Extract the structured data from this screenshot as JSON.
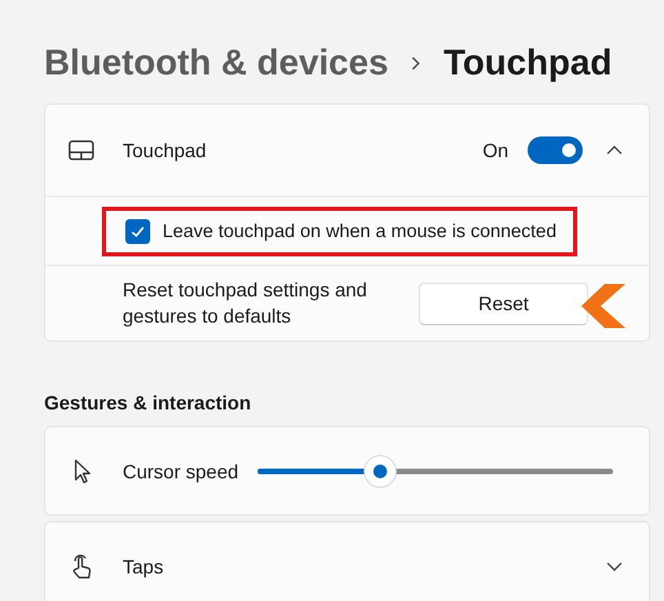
{
  "breadcrumb": {
    "parent": "Bluetooth & devices",
    "current": "Touchpad"
  },
  "touchpad_card": {
    "title": "Touchpad",
    "toggle_label": "On",
    "on": true,
    "expanded": true,
    "leave_on": {
      "label": "Leave touchpad on when a mouse is connected",
      "checked": true,
      "highlighted": true
    },
    "reset": {
      "description": "Reset touchpad settings and gestures to defaults",
      "button": "Reset",
      "pointer_arrow": true
    }
  },
  "section_title": "Gestures & interaction",
  "settings": [
    {
      "kind": "slider",
      "label": "Cursor speed",
      "level": 0.345
    },
    {
      "kind": "expander",
      "label": "Taps",
      "expanded": false
    }
  ]
}
